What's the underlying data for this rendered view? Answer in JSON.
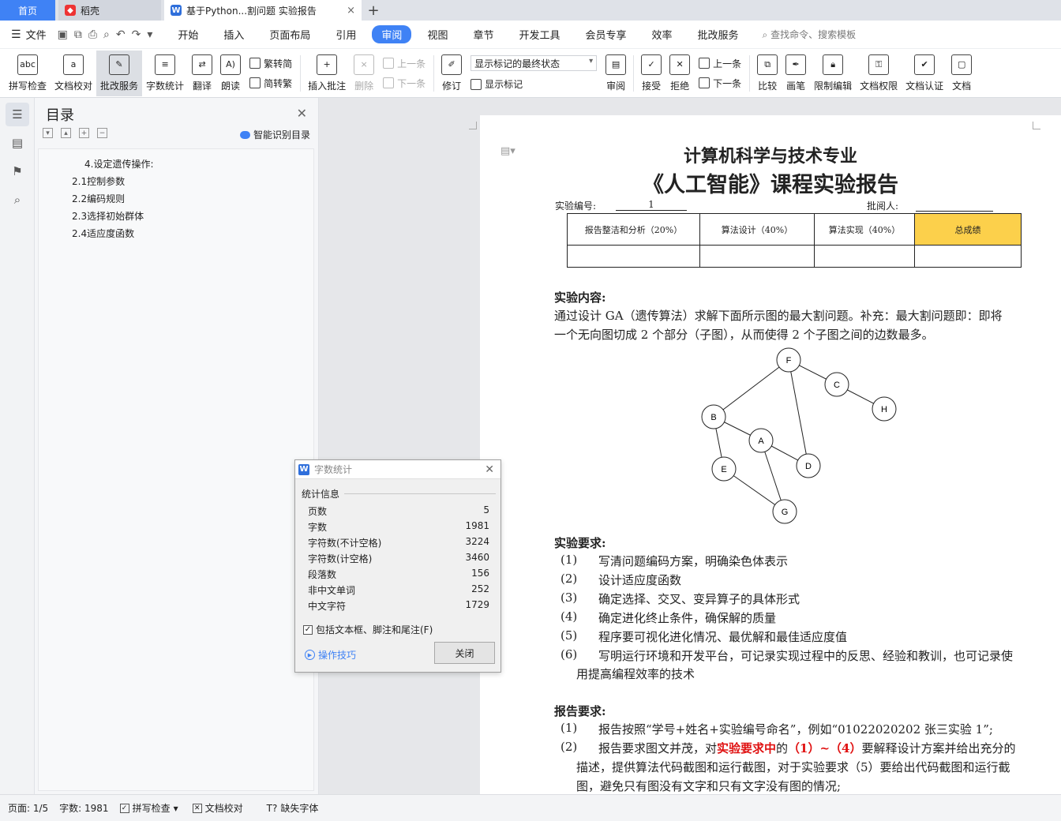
{
  "tabs": {
    "home": "首页",
    "daoke": "稻壳",
    "doc": "基于Python...割问题 实验报告"
  },
  "menubar": {
    "file": "文件",
    "items": [
      "开始",
      "插入",
      "页面布局",
      "引用",
      "审阅",
      "视图",
      "章节",
      "开发工具",
      "会员专享",
      "效率",
      "批改服务"
    ],
    "active": "审阅",
    "search_placeholder": "查找命令、搜索模板"
  },
  "ribbon": {
    "spellcheck": "拼写检查",
    "doc_proof": "文档校对",
    "review_service": "批改服务",
    "word_count": "字数统计",
    "translate": "翻译",
    "read_aloud": "朗读",
    "trad_to_simp": "繁转简",
    "simp_to_trad": "简转繁",
    "insert_comment": "插入批注",
    "delete": "删除",
    "prev": "上一条",
    "next": "下一条",
    "revise": "修订",
    "markup_state": "显示标记的最终状态",
    "show_markup": "显示标记",
    "review": "审阅",
    "accept": "接受",
    "reject": "拒绝",
    "prev2": "上一条",
    "next2": "下一条",
    "compare": "比较",
    "pen": "画笔",
    "restrict_edit": "限制编辑",
    "doc_rights": "文档权限",
    "doc_cert": "文档认证",
    "doc_more": "文档"
  },
  "toc": {
    "title": "目录",
    "smart": "智能识别目录",
    "items": [
      "4.设定遗传操作:",
      "2.1控制参数",
      "2.2编码规则",
      "2.3选择初始群体",
      "2.4适应度函数"
    ]
  },
  "document": {
    "title1": "计算机科学与技术专业",
    "title2": "《人工智能》课程实验报告",
    "exp_no_label": "实验编号:",
    "exp_no_value": "1",
    "reviewer_label": "批阅人:",
    "grade_headers": [
      "报告整洁和分析（20%）",
      "算法设计（40%）",
      "算法实现（40%）",
      "总成绩"
    ],
    "content_heading": "实验内容:",
    "content_line1": "通过设计 GA（遗传算法）求解下面所示图的最大割问题。补充：最大割问题即：即将",
    "content_line2": "一个无向图切成 2 个部分（子图），从而使得 2 个子图之间的边数最多。",
    "graph_nodes": [
      "F",
      "C",
      "H",
      "B",
      "A",
      "D",
      "E",
      "G"
    ],
    "req_heading": "实验要求:",
    "requirements": [
      {
        "num": "(1)",
        "text": "写清问题编码方案，明确染色体表示"
      },
      {
        "num": "(2)",
        "text": "设计适应度函数"
      },
      {
        "num": "(3)",
        "text": "确定选择、交叉、变异算子的具体形式"
      },
      {
        "num": "(4)",
        "text": "确定进化终止条件，确保解的质量"
      },
      {
        "num": "(5)",
        "text": "程序要可视化进化情况、最优解和最佳适应度值"
      },
      {
        "num": "(6)",
        "text": "写明运行环境和开发平台，可记录实现过程中的反思、经验和教训，也可记录使"
      }
    ],
    "req6_cont": "用提高编程效率的技术",
    "report_heading": "报告要求:",
    "report1_num": "(1)",
    "report1_text": "报告按照“学号+姓名+实验编号命名”，例如“01022020202 张三实验 1”;",
    "report2_num": "(2)",
    "report2_a": "报告要求图文并茂，对",
    "report2_red": "实验要求中",
    "report2_b": "的",
    "report2_red2": "（1）~（4）",
    "report2_c": "要解释设计方案并给出充分的",
    "report2_line2": "描述，提供算法代码截图和运行截图，对于实验要求（5）要给出代码截图和运行截",
    "report2_line3": "图，避免只有图没有文字和只有文字没有图的情况;"
  },
  "dialog": {
    "title": "字数统计",
    "section": "统计信息",
    "stats": [
      {
        "label": "页数",
        "value": "5"
      },
      {
        "label": "字数",
        "value": "1981"
      },
      {
        "label": "字符数(不计空格)",
        "value": "3224"
      },
      {
        "label": "字符数(计空格)",
        "value": "3460"
      },
      {
        "label": "段落数",
        "value": "156"
      },
      {
        "label": "非中文单词",
        "value": "252"
      },
      {
        "label": "中文字符",
        "value": "1729"
      }
    ],
    "checkbox": "包括文本框、脚注和尾注(F)",
    "tips": "操作技巧",
    "close": "关闭"
  },
  "status": {
    "page": "页面: 1/5",
    "words": "字数: 1981",
    "spell": "拼写检查",
    "proof": "文档校对",
    "missing_font": "缺失字体"
  },
  "colors": {
    "accent": "#3f82f5",
    "grade_highlight": "#fcd04b",
    "red_text": "#e01010"
  }
}
